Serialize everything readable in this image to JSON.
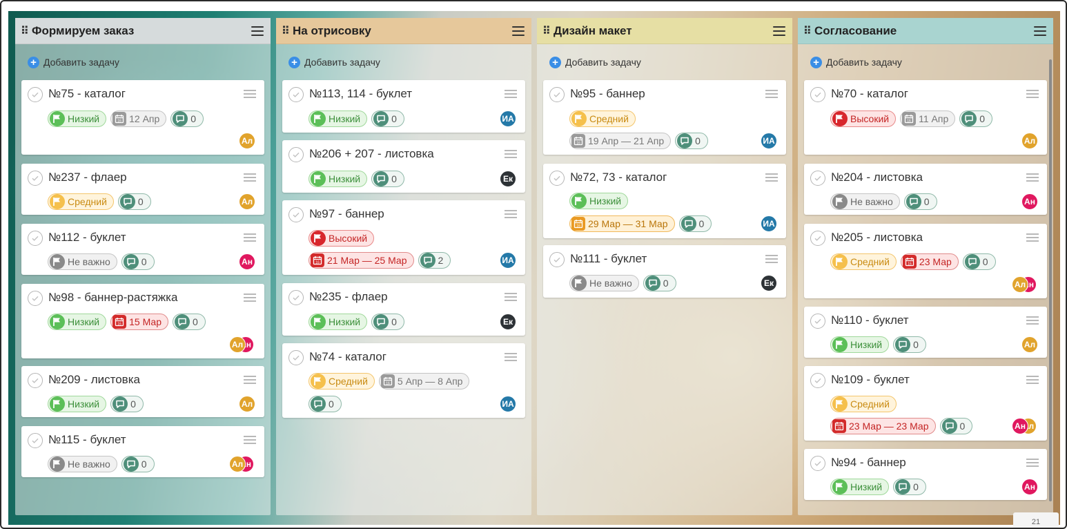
{
  "colors": {
    "col1_head": "#d6dbdc",
    "col2_head": "#e6c89b",
    "col3_head": "#e6dfa4",
    "col4_head": "#a9d4d0",
    "accent_add": "#3a8ee6"
  },
  "icons": {
    "grip": "drag-grip-icon",
    "menu": "hamburger-menu-icon",
    "add": "plus-circle-icon",
    "check": "check-circle-icon",
    "flag": "flag-icon",
    "calendar": "calendar-icon",
    "comment": "comment-icon"
  },
  "columns": [
    {
      "title": "Формируем заказ",
      "add_label": "Добавить задачу",
      "cards": [
        {
          "title": "№75 - каталог",
          "priority": "Низкий",
          "date": "12 Апр",
          "comments": "0",
          "avatars": [
            "Ал"
          ]
        },
        {
          "title": "№237 - флаер",
          "priority": "Средний",
          "comments": "0",
          "avatars": [
            "Ал"
          ]
        },
        {
          "title": "№112 - буклет",
          "priority": "Не важно",
          "comments": "0",
          "avatars": [
            "Ан"
          ]
        },
        {
          "title": "№98 - баннер-растяжка",
          "priority": "Низкий",
          "date": "15 Мар",
          "comments": "0",
          "avatars": [
            "Ал",
            "Ан"
          ]
        },
        {
          "title": "№209 - листовка",
          "priority": "Низкий",
          "comments": "0",
          "avatars": [
            "Ал"
          ]
        },
        {
          "title": "№115 - буклет",
          "priority": "Не важно",
          "comments": "0",
          "avatars": [
            "Ал",
            "Ан"
          ]
        }
      ]
    },
    {
      "title": "На отрисовку",
      "add_label": "Добавить задачу",
      "cards": [
        {
          "title": "№113, 114 - буклет",
          "priority": "Низкий",
          "comments": "0",
          "avatars": [
            "ИА"
          ]
        },
        {
          "title": "№206 + 207 - листовка",
          "priority": "Низкий",
          "comments": "0",
          "avatars": [
            "Ек"
          ]
        },
        {
          "title": "№97 - баннер",
          "priority": "Высокий",
          "date": "21 Мар — 25 Мар",
          "comments": "2",
          "avatars": [
            "ИА"
          ]
        },
        {
          "title": "№235 - флаер",
          "priority": "Низкий",
          "comments": "0",
          "avatars": [
            "Ек"
          ]
        },
        {
          "title": "№74 - каталог",
          "priority": "Средний",
          "date": "5 Апр — 8 Апр",
          "comments": "0",
          "avatars": [
            "ИА"
          ]
        }
      ]
    },
    {
      "title": "Дизайн макет",
      "add_label": "Добавить задачу",
      "cards": [
        {
          "title": "№95 - баннер",
          "priority": "Средний",
          "date": "19 Апр — 21 Апр",
          "comments": "0",
          "avatars": [
            "ИА"
          ]
        },
        {
          "title": "№72, 73 - каталог",
          "priority": "Низкий",
          "date": "29 Мар — 31 Мар",
          "comments": "0",
          "avatars": [
            "ИА"
          ]
        },
        {
          "title": "№111 - буклет",
          "priority": "Не важно",
          "comments": "0",
          "avatars": [
            "Ек"
          ]
        }
      ]
    },
    {
      "title": "Согласование",
      "add_label": "Добавить задачу",
      "cards": [
        {
          "title": "№70 - каталог",
          "priority": "Высокий",
          "date": "11 Апр",
          "comments": "0",
          "avatars": [
            "Ал"
          ]
        },
        {
          "title": "№204 - листовка",
          "priority": "Не важно",
          "comments": "0",
          "avatars": [
            "Ан"
          ]
        },
        {
          "title": "№205 - листовка",
          "priority": "Средний",
          "date": "23 Мар",
          "comments": "0",
          "avatars": [
            "Ал",
            "Ан"
          ]
        },
        {
          "title": "№110 - буклет",
          "priority": "Низкий",
          "comments": "0",
          "avatars": [
            "Ал"
          ]
        },
        {
          "title": "№109 - буклет",
          "priority": "Средний",
          "date": "23 Мар — 23 Мар",
          "comments": "0",
          "avatars": [
            "Ан",
            "Ал"
          ]
        },
        {
          "title": "№94 - баннер",
          "priority": "Низкий",
          "comments": "0",
          "avatars": [
            "Ан"
          ]
        }
      ]
    }
  ],
  "corner_tag": "21"
}
